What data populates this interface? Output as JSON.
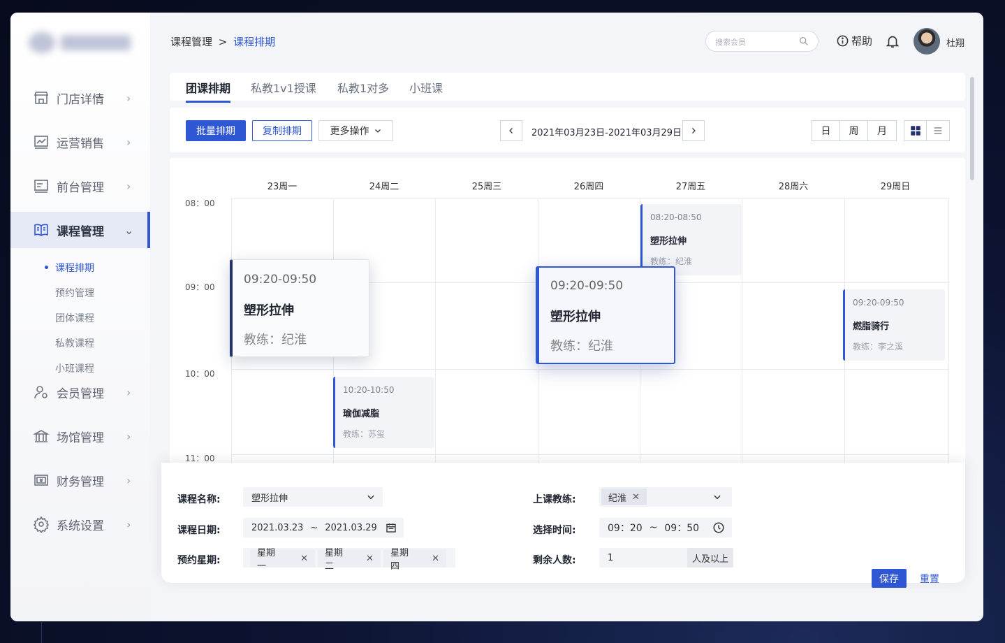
{
  "header": {
    "breadcrumb_parent": "课程管理",
    "breadcrumb_sep": ">",
    "breadcrumb_current": "课程排期",
    "search_placeholder": "搜索会员",
    "help_label": "帮助",
    "username": "杜翔"
  },
  "sidebar": {
    "items": [
      {
        "label": "门店详情",
        "icon": "store-icon"
      },
      {
        "label": "运营销售",
        "icon": "chart-icon"
      },
      {
        "label": "前台管理",
        "icon": "desk-icon"
      },
      {
        "label": "课程管理",
        "icon": "book-icon"
      },
      {
        "label": "会员管理",
        "icon": "user-icon"
      },
      {
        "label": "场馆管理",
        "icon": "building-icon"
      },
      {
        "label": "财务管理",
        "icon": "finance-icon"
      },
      {
        "label": "系统设置",
        "icon": "gear-icon"
      }
    ],
    "sub_items": [
      "课程排期",
      "预约管理",
      "团体课程",
      "私教课程",
      "小班课程"
    ]
  },
  "tabs": [
    "团课排期",
    "私教1v1授课",
    "私教1对多",
    "小班课"
  ],
  "toolbar": {
    "batch_label": "批量排期",
    "copy_label": "复制排期",
    "more_label": "更多操作",
    "date_range": "2021年03月23日-2021年03月29日",
    "view_day": "日",
    "view_week": "周",
    "view_month": "月"
  },
  "calendar": {
    "days": [
      "23周一",
      "24周二",
      "25周三",
      "26周四",
      "27周五",
      "28周六",
      "29周日"
    ],
    "times": [
      "08：00",
      "09：00",
      "10：00",
      "11：00"
    ],
    "events": [
      {
        "time": "09:20-09:50",
        "name": "塑形拉伸",
        "coach": "教练：纪淮"
      },
      {
        "time": "10:20-10:50",
        "name": "瑜伽减脂",
        "coach": "教练：苏玺"
      },
      {
        "time": "09:20-09:50",
        "name": "塑形拉伸",
        "coach": "教练：纪淮"
      },
      {
        "time": "08:20-08:50",
        "name": "塑形拉伸",
        "coach": "教练：纪淮"
      },
      {
        "time": "09:20-09:50",
        "name": "燃脂骑行",
        "coach": "教练：李之溪"
      }
    ]
  },
  "form": {
    "course_name_label": "课程名称:",
    "course_name_value": "塑形拉伸",
    "course_date_label": "课程日期:",
    "date_start": "2021.03.23",
    "date_sep": "~",
    "date_end": "2021.03.29",
    "weekday_label": "预约星期:",
    "weekdays": [
      "星期一",
      "星期二",
      "星期四"
    ],
    "coach_label": "上课教练:",
    "coach_tag": "纪淮",
    "time_label": "选择时间:",
    "time_start": "09：20",
    "time_sep": "~",
    "time_end": "09：50",
    "remaining_label": "剩余人数:",
    "remaining_value": "1",
    "remaining_suffix": "人及以上",
    "save_label": "保存",
    "reset_label": "重置"
  },
  "colors": {
    "accent": "#2f57d4",
    "dark_accent": "#24336e"
  }
}
